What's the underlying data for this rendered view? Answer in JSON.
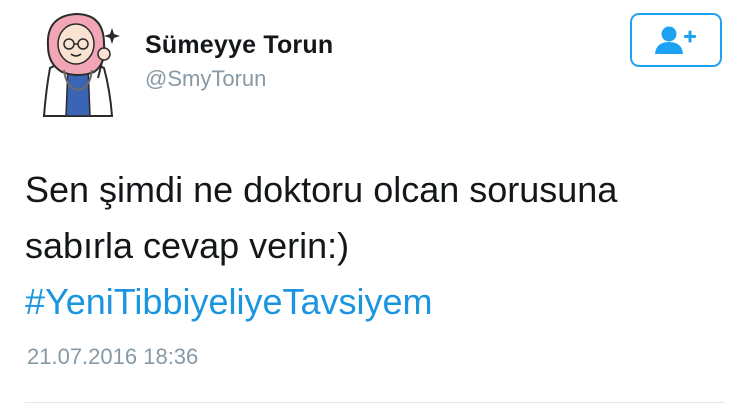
{
  "tweet": {
    "author": {
      "display_name": "Sümeyye Torun",
      "handle": "@SmyTorun",
      "avatar_icon": "doctor-avatar-icon"
    },
    "follow_button": {
      "icon": "add-user-icon",
      "color": "#1da1f2"
    },
    "text_lines": [
      "Sen şimdi ne doktoru olcan sorusuna",
      "sabırla cevap verin:)"
    ],
    "hashtag": "#YeniTibbiyeliyeTavsiyem",
    "timestamp": "21.07.2016 18:36"
  },
  "colors": {
    "text": "#14171a",
    "muted": "#8899a6",
    "link": "#1b95e0",
    "accent": "#1da1f2",
    "divider": "#e1e8ed"
  }
}
